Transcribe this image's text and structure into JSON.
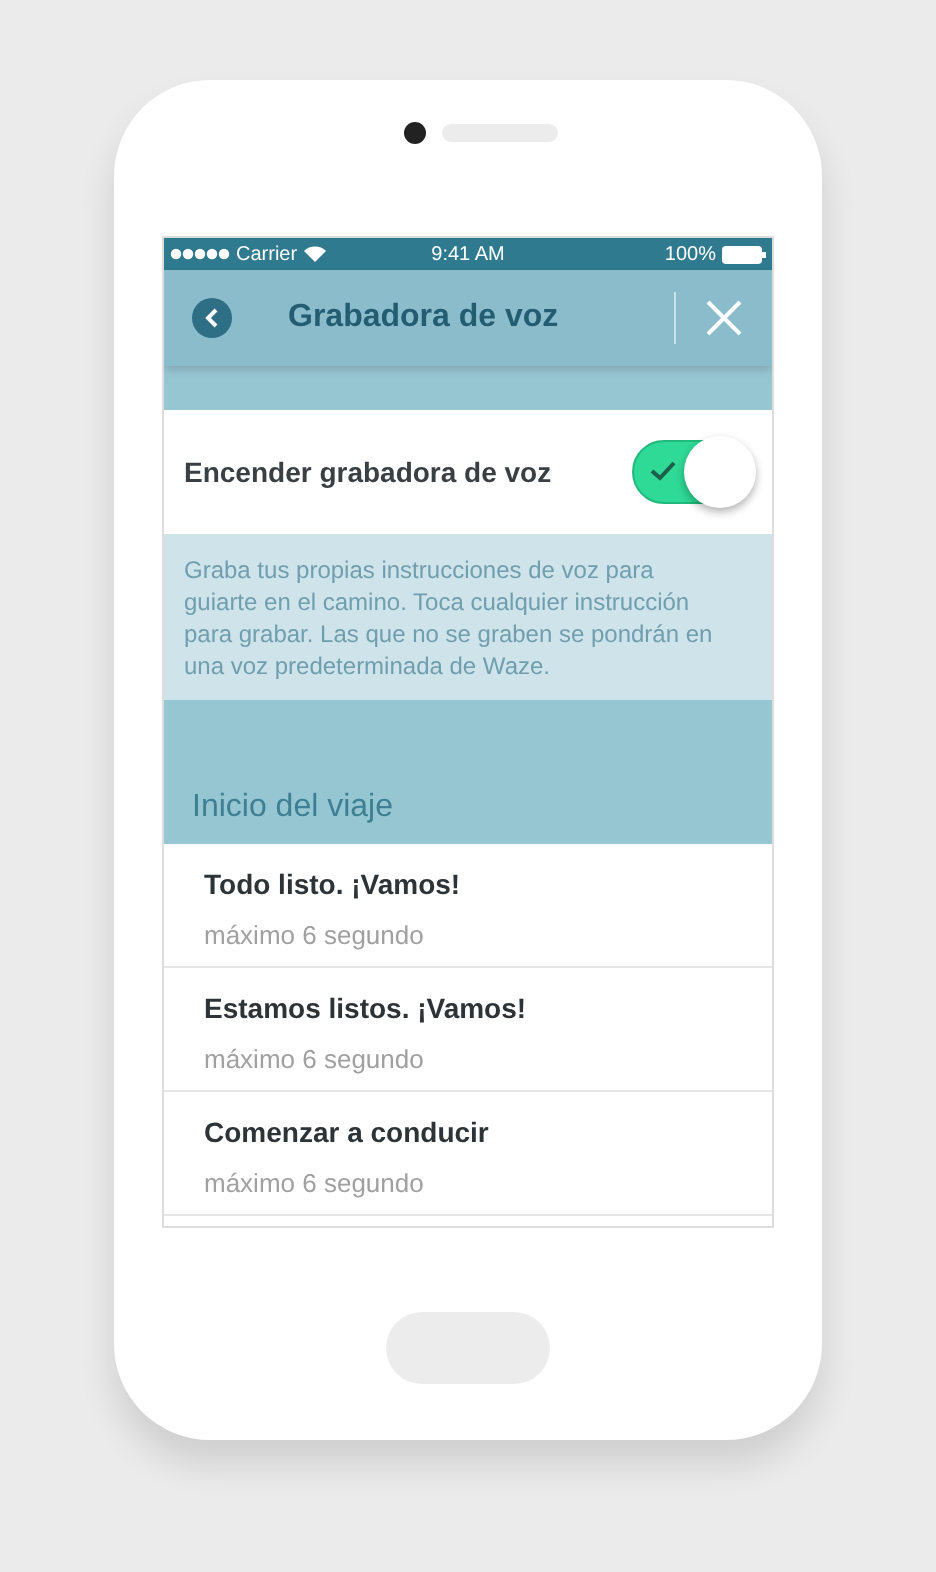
{
  "status_bar": {
    "carrier": "Carrier",
    "time": "9:41 AM",
    "battery": "100%"
  },
  "header": {
    "title": "Grabadora de voz"
  },
  "toggle": {
    "label": "Encender grabadora de voz",
    "on": true
  },
  "description": "Graba tus propias instrucciones de voz para guiarte en el camino. Toca cualquier instrucción para grabar. Las que no se graben se pondrán en una voz predeterminada de Waze.",
  "section": {
    "title": "Inicio del viaje"
  },
  "items": [
    {
      "title": "Todo listo. ¡Vamos!",
      "subtitle": "máximo 6 segundo"
    },
    {
      "title": "Estamos listos. ¡Vamos!",
      "subtitle": "máximo 6 segundo"
    },
    {
      "title": "Comenzar a conducir",
      "subtitle": "máximo 6 segundo"
    }
  ]
}
